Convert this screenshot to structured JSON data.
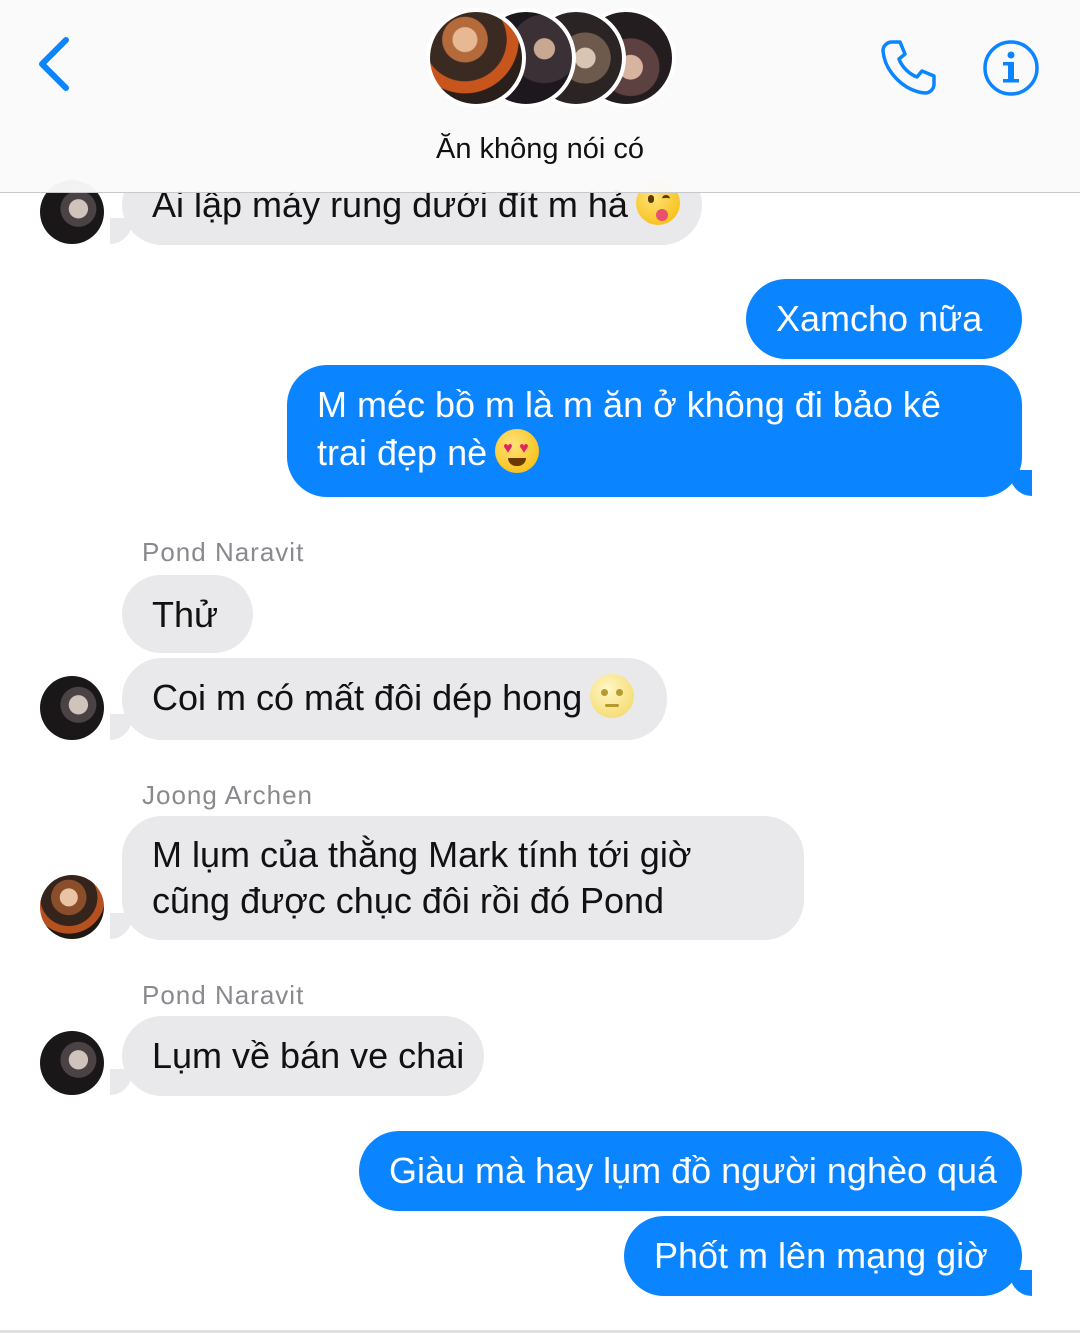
{
  "header": {
    "title": "Ăn không nói có",
    "accent_color": "#0a84ff",
    "icons": [
      "chevron-left-icon",
      "phone-icon",
      "info-icon"
    ]
  },
  "messages": [
    {
      "type": "incoming",
      "text": "Ai lập máy rung dưới đít m hả",
      "emoji": "face-savoring-food"
    },
    {
      "type": "outgoing",
      "text": "Xamcho nữa"
    },
    {
      "type": "outgoing",
      "text": "M méc bồ m là m ăn ở không đi bảo kê trai đẹp nè",
      "emoji": "heart-eyes"
    },
    {
      "type": "incoming",
      "sender": "Pond Naravit",
      "text": "Thử"
    },
    {
      "type": "incoming",
      "text": "Coi m có mất đôi dép hong",
      "emoji": "full-moon-face"
    },
    {
      "type": "incoming",
      "sender": "Joong Archen",
      "text": "M lụm của thằng Mark tính tới giờ cũng được chục đôi rồi đó Pond"
    },
    {
      "type": "incoming",
      "sender": "Pond Naravit",
      "text": "Lụm về bán ve chai"
    },
    {
      "type": "outgoing",
      "text": "Giàu mà hay lụm đồ người nghèo quá"
    },
    {
      "type": "outgoing",
      "text": "Phốt m lên mạng giờ"
    }
  ],
  "colors": {
    "incoming_bubble": "#e9e9eb",
    "outgoing_bubble": "#0a84ff",
    "sender_name": "#8a8a8e"
  }
}
